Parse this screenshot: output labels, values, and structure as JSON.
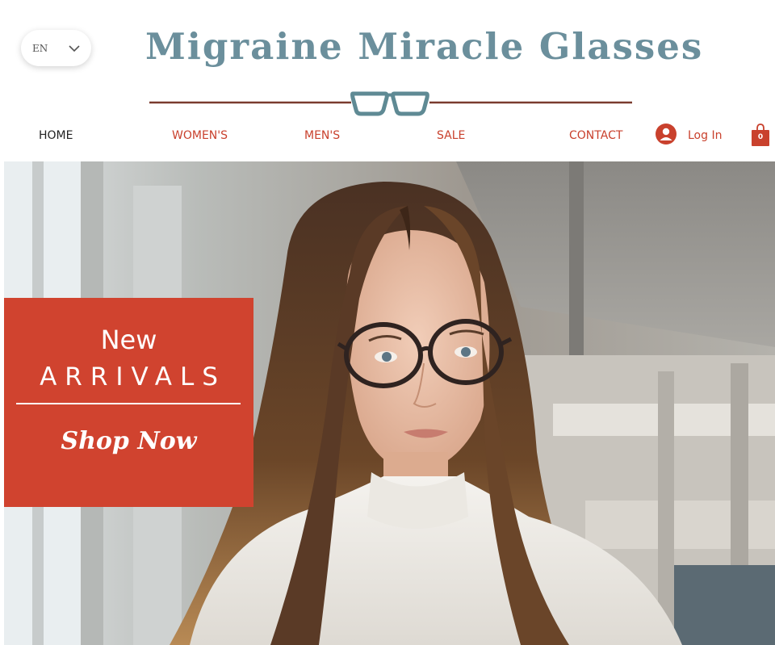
{
  "language": {
    "code": "EN",
    "icon": "chevron-down-icon"
  },
  "logo": {
    "title": "Migraine Miracle Glasses",
    "line_color": "#7a3b2e",
    "glasses_color": "#5f8a94"
  },
  "nav": {
    "items": [
      {
        "label": "HOME",
        "active": true
      },
      {
        "label": "WOMEN'S",
        "active": false
      },
      {
        "label": "MEN'S",
        "active": false
      },
      {
        "label": "SALE",
        "active": false
      },
      {
        "label": "CONTACT",
        "active": false
      }
    ],
    "login_label": "Log In",
    "cart_count": "0"
  },
  "colors": {
    "accent": "#d0432f",
    "brand": "#6b8f9c",
    "text": "#222222"
  },
  "promo": {
    "line1": "New",
    "line2": "ARRIVALS",
    "cta": "Shop Now"
  }
}
